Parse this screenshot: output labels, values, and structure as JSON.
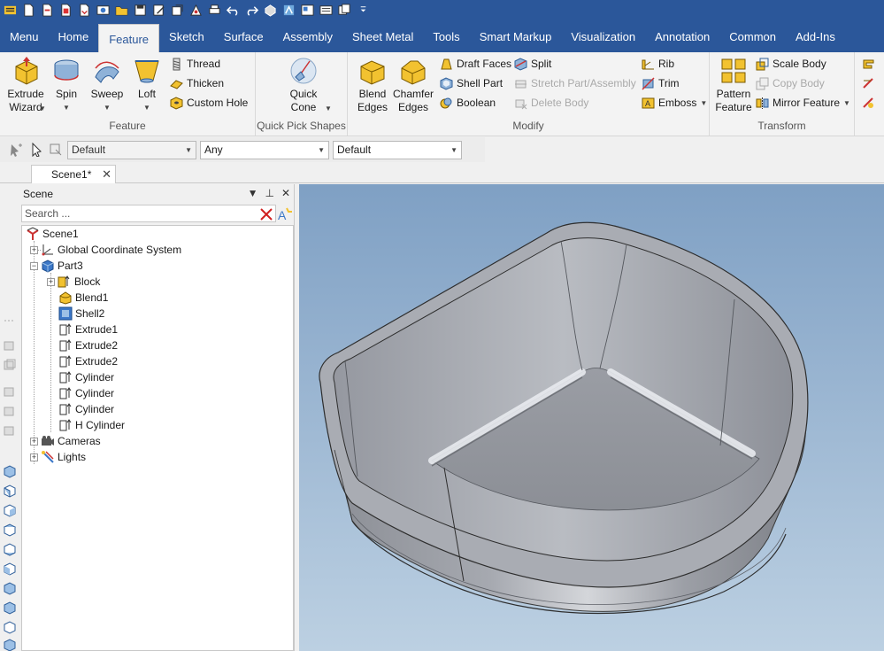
{
  "ribbon_tabs": [
    "Menu",
    "Home",
    "Feature",
    "Sketch",
    "Surface",
    "Assembly",
    "Sheet Metal",
    "Tools",
    "Smart Markup",
    "Visualization",
    "Annotation",
    "Common",
    "Add-Ins"
  ],
  "active_tab": "Feature",
  "ribbon": {
    "feature_group": {
      "label": "Feature",
      "extrude_wizard": "Extrude\nWizard",
      "spin": "Spin",
      "sweep": "Sweep",
      "loft": "Loft",
      "thread": "Thread",
      "thicken": "Thicken",
      "custom_hole": "Custom Hole"
    },
    "quick_pick": {
      "label": "Quick Pick Shapes",
      "quick_cone": "Quick\nCone"
    },
    "modify": {
      "label": "Modify",
      "blend_edges": "Blend\nEdges",
      "chamfer_edges": "Chamfer\nEdges",
      "draft_faces": "Draft Faces",
      "shell_part": "Shell Part",
      "boolean": "Boolean",
      "split": "Split",
      "stretch": "Stretch Part/Assembly",
      "delete_body": "Delete Body",
      "rib": "Rib",
      "trim": "Trim",
      "emboss": "Emboss"
    },
    "transform": {
      "label": "Transform",
      "pattern_feature": "Pattern\nFeature",
      "scale_body": "Scale Body",
      "copy_body": "Copy Body",
      "mirror_feature": "Mirror Feature"
    }
  },
  "toolbar": {
    "style_combo": "Default",
    "filter_combo": "Any",
    "material_combo": "Default"
  },
  "document_tab": "Scene1*",
  "scene_panel": {
    "title": "Scene",
    "search_placeholder": "Search ...",
    "tree": [
      {
        "label": "Scene1"
      },
      {
        "label": "Global Coordinate System"
      },
      {
        "label": "Part3"
      },
      {
        "label": "Block"
      },
      {
        "label": "Blend1"
      },
      {
        "label": "Shell2"
      },
      {
        "label": "Extrude1"
      },
      {
        "label": "Extrude2"
      },
      {
        "label": "Extrude2"
      },
      {
        "label": "Cylinder"
      },
      {
        "label": "Cylinder"
      },
      {
        "label": "Cylinder"
      },
      {
        "label": "H Cylinder"
      },
      {
        "label": "Cameras"
      },
      {
        "label": "Lights"
      }
    ]
  },
  "colors": {
    "ribbon_blue": "#2b579a",
    "icon_yellow": "#f2c230",
    "icon_blue": "#3c78c8",
    "model_gray": "#8c8f96",
    "viewport_top": "#7fa0c4",
    "viewport_bottom": "#bcd0e2"
  }
}
